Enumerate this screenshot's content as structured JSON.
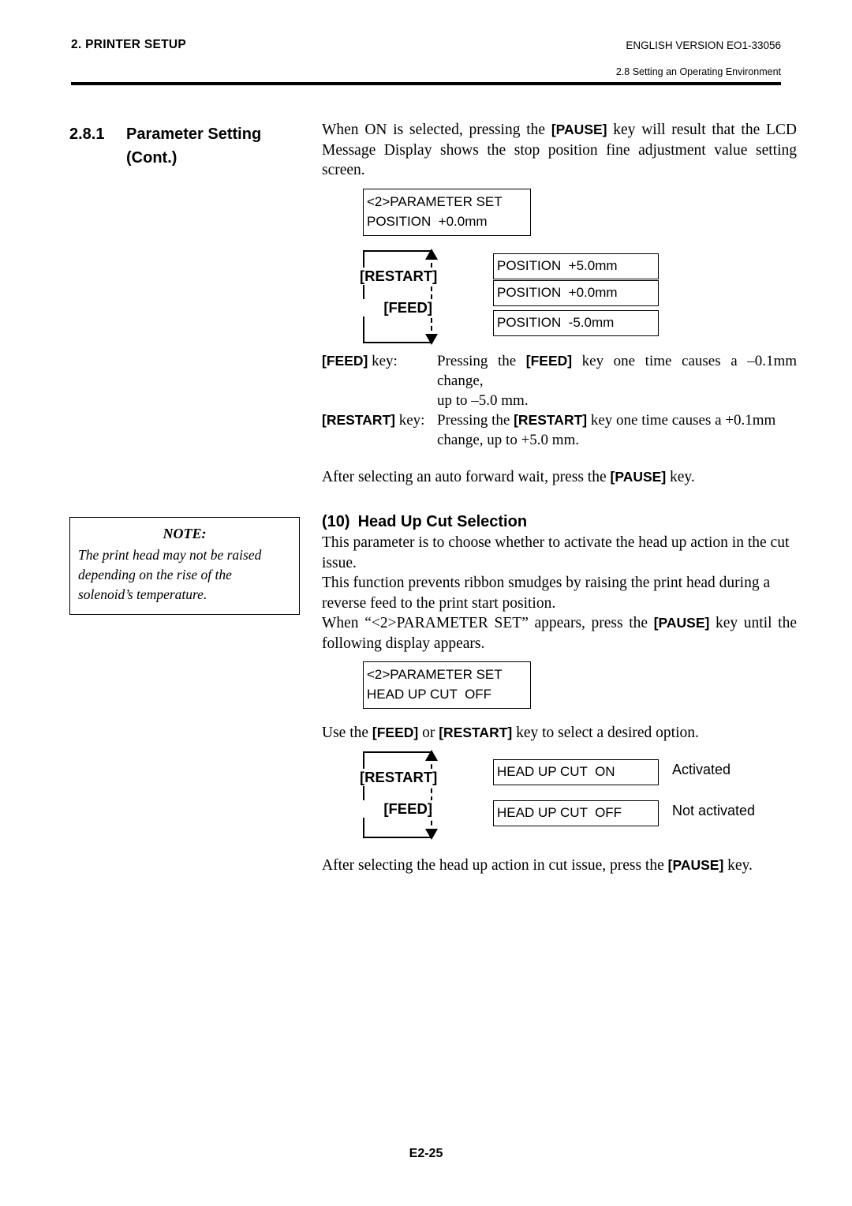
{
  "header": {
    "left_title": "2. PRINTER SETUP",
    "version": "ENGLISH VERSION EO1-33056",
    "subsection": "2.8 Setting an Operating Environment"
  },
  "left_column": {
    "section_number": "2.8.1",
    "section_title_line1": "Parameter Setting",
    "section_title_line2": "(Cont.)",
    "note": {
      "title": "NOTE:",
      "line1": "The print head may not be raised",
      "line2": "depending on the rise of the",
      "line3": "solenoid’s temperature."
    }
  },
  "body": {
    "intro_paragraph": {
      "pre": "When ON is selected, pressing the ",
      "key": "[PAUSE]",
      "post": " key will result that the LCD Message Display shows the stop position fine adjustment value setting screen."
    },
    "lcd_parameter_position": {
      "line1": "<2>PARAMETER SET",
      "line2": "POSITION  +0.0mm"
    },
    "position_diagram": {
      "key_up": "[RESTART]",
      "key_down": "[FEED]",
      "options": [
        "POSITION  +5.0mm",
        "POSITION  +0.0mm",
        "POSITION  -5.0mm"
      ]
    },
    "key_descriptions": [
      {
        "label_key": "[FEED]",
        "label_suffix": " key:",
        "text_pre": "Pressing the ",
        "text_key": "[FEED]",
        "text_post": " key one time causes a –0.1mm change,",
        "text_cont": "up to –5.0 mm."
      },
      {
        "label_key": "[RESTART]",
        "label_suffix": " key:",
        "text_pre": "Pressing the ",
        "text_key": "[RESTART]",
        "text_post": " key one time causes a +0.1mm",
        "text_cont": "change, up to +5.0 mm."
      }
    ],
    "after_auto_forward": {
      "pre": "After selecting an auto forward wait, press the ",
      "key": "[PAUSE]",
      "post": " key."
    },
    "subsection": {
      "number": "(10)",
      "title": "Head Up Cut Selection"
    },
    "head_up_paragraph_1": "This parameter is to choose whether to activate the head up action in the cut issue.",
    "head_up_paragraph_2": "This function prevents ribbon smudges by raising the print head during a reverse feed to the print start position.",
    "head_up_paragraph_3": {
      "pre": "When “<2>PARAMETER SET” appears, press the ",
      "key": "[PAUSE]",
      "post": " key until the following display appears."
    },
    "lcd_parameter_headup": {
      "line1": "<2>PARAMETER SET",
      "line2": "HEAD UP CUT  OFF"
    },
    "use_keys_line": {
      "pre": "Use the ",
      "key1": "[FEED]",
      "mid": " or ",
      "key2": "[RESTART]",
      "post": " key to select a desired option."
    },
    "headup_diagram": {
      "key_up": "[RESTART]",
      "key_down": "[FEED]",
      "options": [
        {
          "value": "HEAD UP CUT  ON",
          "note": "Activated"
        },
        {
          "value": "HEAD UP CUT  OFF",
          "note": "Not activated"
        }
      ]
    },
    "closing_line": {
      "pre": "After selecting the head up action in cut issue, press the ",
      "key": "[PAUSE]",
      "post": " key."
    }
  },
  "footer": {
    "page_number": "E2-25"
  }
}
